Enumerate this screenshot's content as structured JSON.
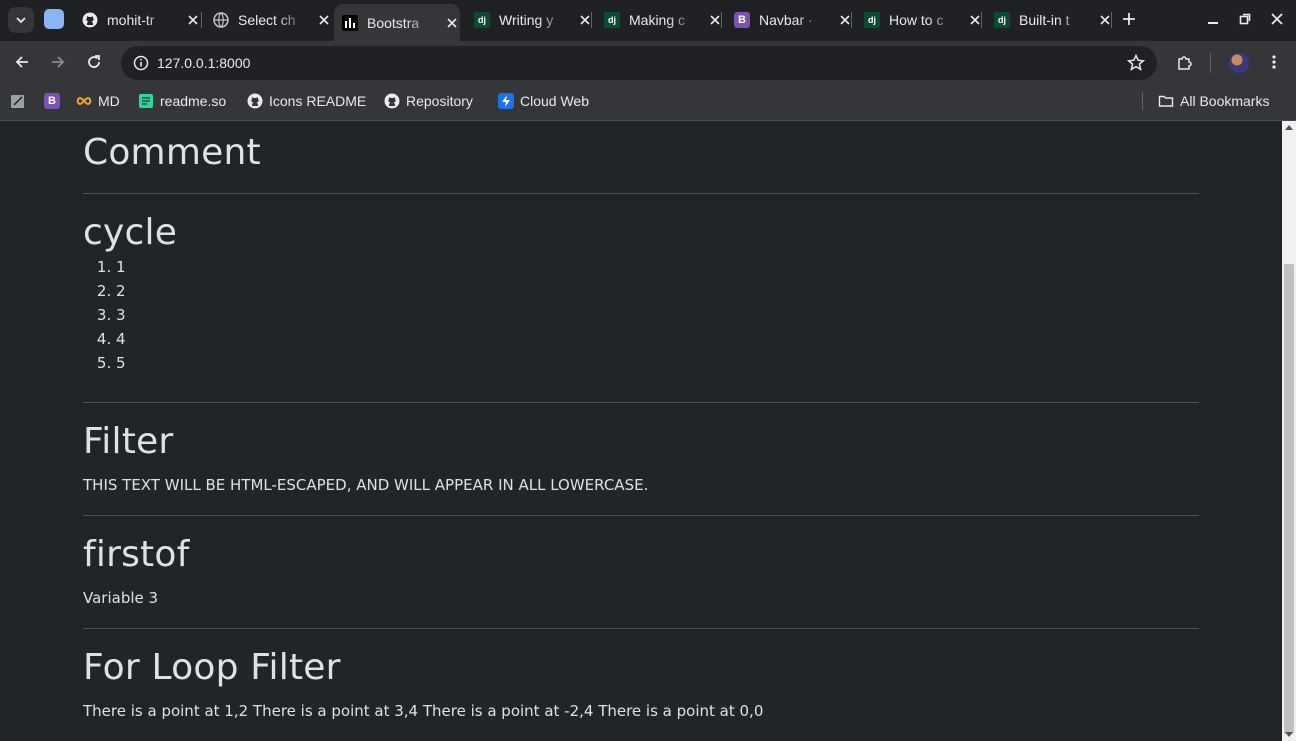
{
  "tabs": [
    {
      "title": "mohit-tr",
      "favicon": "github-icon"
    },
    {
      "title": "Select ch",
      "favicon": "globe-icon"
    },
    {
      "title": "Bootstra",
      "favicon": "chart-icon",
      "active": true
    },
    {
      "title": "Writing y",
      "favicon": "django-icon",
      "favicon_text": "dj"
    },
    {
      "title": "Making c",
      "favicon": "django-icon",
      "favicon_text": "dj"
    },
    {
      "title": "Navbar ·",
      "favicon": "bootstrap-icon",
      "favicon_text": "B"
    },
    {
      "title": "How to c",
      "favicon": "django-icon",
      "favicon_text": "dj"
    },
    {
      "title": "Built-in t",
      "favicon": "django-icon",
      "favicon_text": "dj"
    }
  ],
  "address_bar": {
    "url": "127.0.0.1:8000"
  },
  "bookmarks": [
    {
      "label": "",
      "icon": "notes-icon"
    },
    {
      "label": "",
      "icon": "bootstrap-icon",
      "icon_text": "B"
    },
    {
      "label": "MD",
      "icon": "infinity-icon"
    },
    {
      "label": "readme.so",
      "icon": "readme-icon"
    },
    {
      "label": "Icons README",
      "icon": "github-icon"
    },
    {
      "label": "Repository",
      "icon": "github-icon"
    },
    {
      "label": "Cloud Web",
      "icon": "lightning-icon"
    }
  ],
  "all_bookmarks_label": "All Bookmarks",
  "page": {
    "comment_title": "Comment",
    "cycle_title": "cycle",
    "cycle_items": [
      "1",
      "2",
      "3",
      "4",
      "5"
    ],
    "filter_title": "Filter",
    "filter_text": "THIS TEXT WILL BE HTML-ESCAPED, AND WILL APPEAR IN ALL LOWERCASE.",
    "firstof_title": "firstof",
    "firstof_text": "Variable 3",
    "forloop_title": "For Loop Filter",
    "forloop_text": "There is a point at 1,2 There is a point at 3,4 There is a point at -2,4 There is a point at 0,0"
  },
  "colors": {
    "page_bg": "#212529",
    "text": "#dee2e6",
    "chrome_bg": "#35363a"
  }
}
